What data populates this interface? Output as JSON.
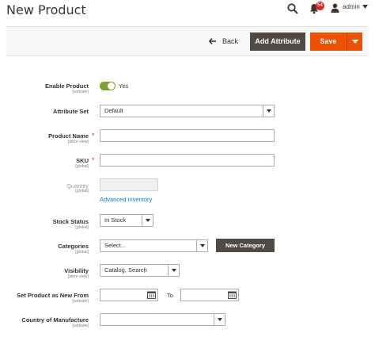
{
  "header": {
    "title": "New Product",
    "notifications_count": "54",
    "user_name": "admin",
    "icons": [
      "search-icon",
      "bell-icon",
      "user-icon",
      "caret-down-icon"
    ]
  },
  "actions": {
    "back_label": "Back",
    "add_attribute_label": "Add Attribute",
    "save_label": "Save"
  },
  "colors": {
    "primary_action": "#eb5202",
    "secondary_action": "#514943",
    "toggle_on": "#79a22e",
    "link": "#007bdb",
    "required": "#e02b27",
    "badge": "#e22626"
  },
  "form": {
    "enable_product": {
      "label": "Enable Product",
      "scope": "[website]",
      "value": "Yes",
      "enabled": true
    },
    "attribute_set": {
      "label": "Attribute Set",
      "value": "Default"
    },
    "product_name": {
      "label": "Product Name",
      "scope": "[store view]",
      "value": "",
      "required": true
    },
    "sku": {
      "label": "SKU",
      "scope": "[global]",
      "value": "",
      "required": true
    },
    "quantity": {
      "label": "Quantity",
      "scope": "[global]",
      "value": "",
      "link": "Advanced Inventory"
    },
    "stock_status": {
      "label": "Stock Status",
      "scope": "[global]",
      "value": "In Stock"
    },
    "categories": {
      "label": "Categories",
      "scope": "[global]",
      "placeholder": "Select...",
      "button": "New Category"
    },
    "visibility": {
      "label": "Visibility",
      "scope": "[store view]",
      "value": "Catalog, Search"
    },
    "new_from": {
      "label": "Set Product as New From",
      "scope": "[website]",
      "to_label": "To",
      "from_value": "",
      "to_value": ""
    },
    "country_of_manufacture": {
      "label": "Country of Manufacture",
      "scope": "[website]",
      "value": ""
    }
  }
}
